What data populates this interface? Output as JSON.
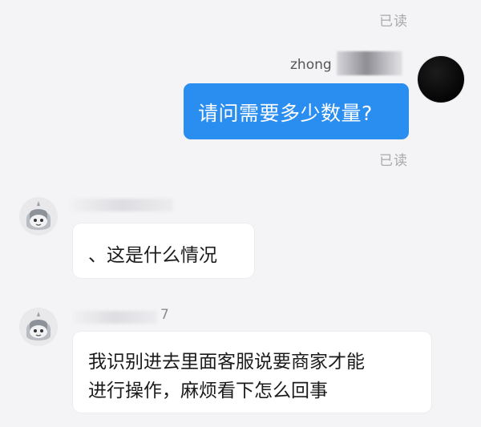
{
  "conversation": {
    "read_label_top": "已读",
    "read_label_middle": "已读",
    "self_message": {
      "sender_name": "zhong",
      "text": "请问需要多少数量?"
    },
    "other_messages": [
      {
        "sender_suffix": "",
        "text": "、这是什么情况"
      },
      {
        "sender_suffix": "7",
        "lines": [
          "我识别进去里面客服说要商家才能",
          "进行操作，麻烦看下怎么回事"
        ]
      }
    ],
    "colors": {
      "self_bubble": "#2a8df0",
      "other_bubble": "#ffffff",
      "background": "#f4f4f6",
      "read_status": "#a9a9ae"
    },
    "icons": {
      "self_avatar": "dark-avatar-icon",
      "other_avatar": "cartoon-helmet-avatar-icon"
    }
  }
}
